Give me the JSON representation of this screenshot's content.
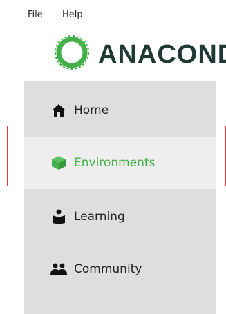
{
  "menubar": {
    "file_label": "File",
    "help_label": "Help"
  },
  "logo": {
    "text": "ANACONDA"
  },
  "sidebar": {
    "items": [
      {
        "label": "Home",
        "icon": "home-icon"
      },
      {
        "label": "Environments",
        "icon": "cube-icon",
        "active": true
      },
      {
        "label": "Learning",
        "icon": "book-reader-icon"
      },
      {
        "label": "Community",
        "icon": "people-icon"
      }
    ]
  },
  "colors": {
    "active": "#43b049",
    "sidebar_bg": "#dedede",
    "highlight_border": "#e53935",
    "logo_text": "#1f3a34"
  }
}
